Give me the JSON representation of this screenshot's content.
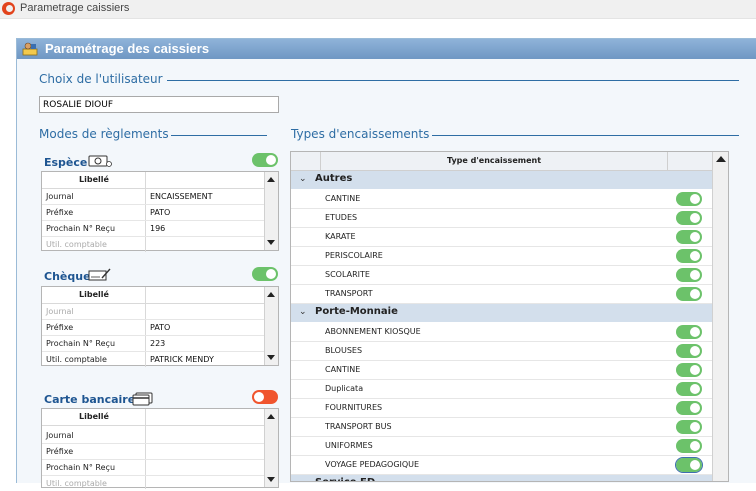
{
  "window": {
    "title": "Parametrage caissiers"
  },
  "panel": {
    "title": "Paramétrage des caissiers"
  },
  "user_section": {
    "title": "Choix de l'utilisateur",
    "selected_user": "ROSALIE DIOUF"
  },
  "modes_section": {
    "title": "Modes de règlements"
  },
  "types_section": {
    "title": "Types d'encaissements",
    "column_header": "Type d'encaissement"
  },
  "modes": [
    {
      "label": "Espèce",
      "icon": "cash-icon",
      "enabled": true,
      "header": "Libellé",
      "rows": [
        {
          "label": "Journal",
          "value": "ENCAISSEMENT",
          "dim": false
        },
        {
          "label": "Préfixe",
          "value": "PATO",
          "dim": false
        },
        {
          "label": "Prochain N° Reçu",
          "value": "196",
          "dim": false
        },
        {
          "label": "Util. comptable",
          "value": "",
          "dim": true
        }
      ]
    },
    {
      "label": "Chèque",
      "icon": "cheque-icon",
      "enabled": true,
      "header": "Libellé",
      "rows": [
        {
          "label": "Journal",
          "value": "",
          "dim": true
        },
        {
          "label": "Préfixe",
          "value": "PATO",
          "dim": false
        },
        {
          "label": "Prochain N° Reçu",
          "value": "223",
          "dim": false
        },
        {
          "label": "Util. comptable",
          "value": "PATRICK MENDY",
          "dim": false
        }
      ]
    },
    {
      "label": "Carte bancaire",
      "icon": "credit-card-icon",
      "enabled": false,
      "header": "Libellé",
      "rows": [
        {
          "label": "Journal",
          "value": "",
          "dim": false
        },
        {
          "label": "Préfixe",
          "value": "",
          "dim": false
        },
        {
          "label": "Prochain N° Reçu",
          "value": "",
          "dim": false
        },
        {
          "label": "Util. comptable",
          "value": "",
          "dim": true
        }
      ]
    }
  ],
  "encaissement_groups": [
    {
      "name": "Autres",
      "items": [
        "CANTINE",
        "ETUDES",
        "KARATE",
        "PERISCOLAIRE",
        "SCOLARITE",
        "TRANSPORT"
      ]
    },
    {
      "name": "Porte-Monnaie",
      "items": [
        "ABONNEMENT KIOSQUE",
        "BLOUSES",
        "CANTINE",
        "Duplicata",
        "FOURNITURES",
        "TRANSPORT BUS",
        "UNIFORMES",
        "VOYAGE PEDAGOGIQUE"
      ]
    },
    {
      "name": "Service ED",
      "items": []
    }
  ],
  "colors": {
    "toggle_on": "#6cc26a",
    "toggle_off": "#f0552e",
    "accent": "#2e6da4",
    "header_bar": "#7aa3cd",
    "group_bg": "#d3dfec"
  }
}
